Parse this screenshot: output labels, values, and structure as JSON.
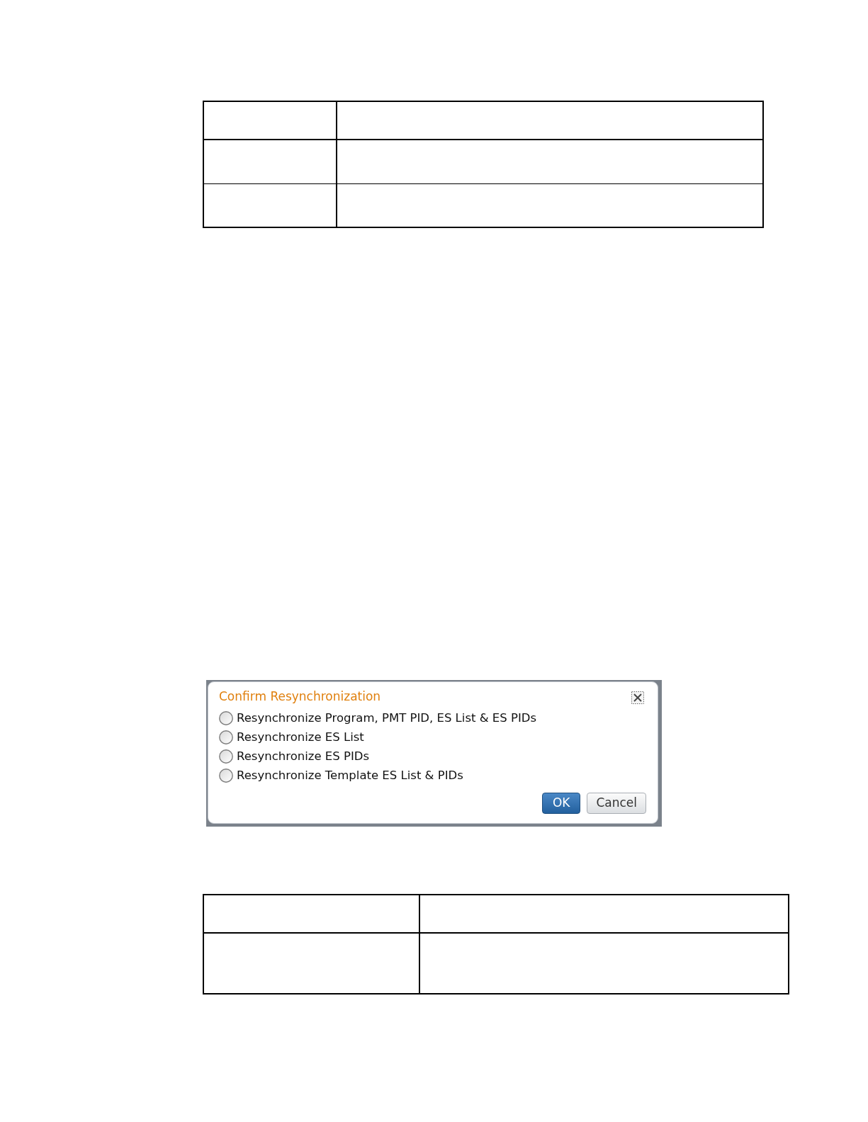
{
  "table_1": {
    "rows": [
      {
        "kind": "header"
      },
      {
        "kind": "single"
      },
      {
        "kind": "single"
      }
    ]
  },
  "dialog": {
    "title": "Confirm Resynchronization",
    "options": [
      {
        "label": "Resynchronize Program, PMT PID, ES List & ES PIDs",
        "selected": false
      },
      {
        "label": "Resynchronize ES List",
        "selected": false
      },
      {
        "label": "Resynchronize ES PIDs",
        "selected": false
      },
      {
        "label": "Resynchronize Template ES List & PIDs",
        "selected": false
      }
    ],
    "buttons": [
      {
        "label": "OK",
        "kind": "primary"
      },
      {
        "label": "Cancel",
        "kind": "secondary"
      }
    ]
  },
  "table_2": {
    "rows": [
      {
        "kind": "header"
      },
      {
        "kind": "double"
      }
    ]
  }
}
